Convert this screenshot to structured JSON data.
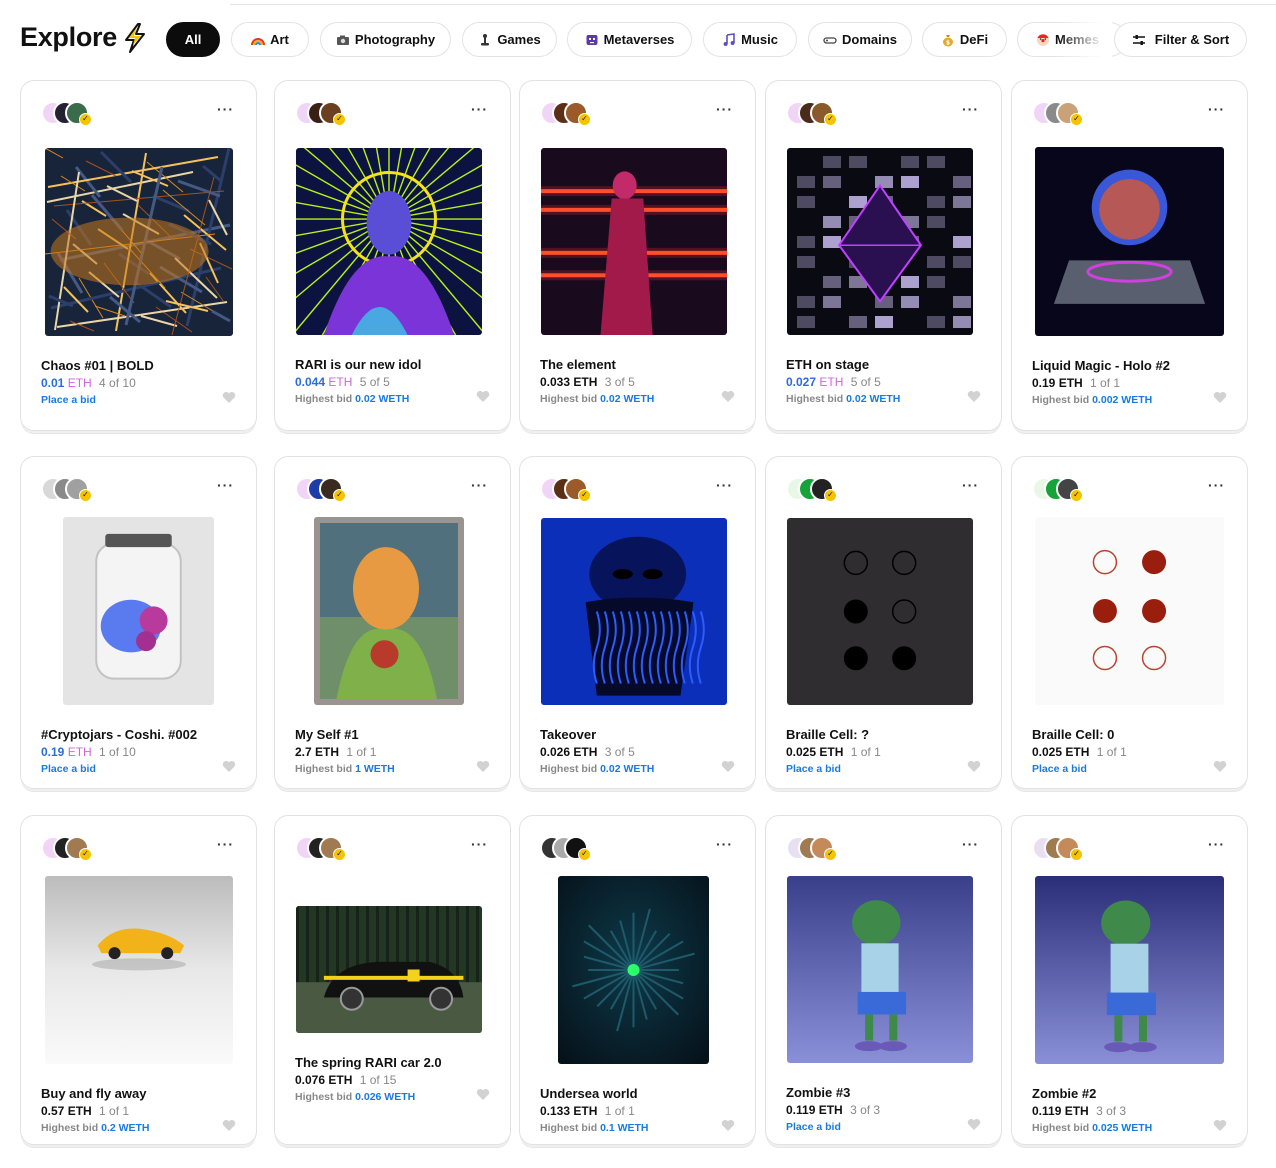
{
  "header": {
    "title": "Explore",
    "filters": [
      {
        "label": "All",
        "icon": "",
        "active": true
      },
      {
        "label": "Art",
        "icon": "rainbow-icon",
        "active": false
      },
      {
        "label": "Photography",
        "icon": "camera-icon",
        "active": false
      },
      {
        "label": "Games",
        "icon": "joystick-icon",
        "active": false
      },
      {
        "label": "Metaverses",
        "icon": "alien-icon",
        "active": false
      },
      {
        "label": "Music",
        "icon": "music-note-icon",
        "active": false
      },
      {
        "label": "Domains",
        "icon": "domain-icon",
        "active": false
      },
      {
        "label": "DeFi",
        "icon": "money-bag-icon",
        "active": false
      },
      {
        "label": "Memes",
        "icon": "clown-icon",
        "active": false
      }
    ],
    "filter_sort_label": "Filter & Sort"
  },
  "colors": {
    "accent_blue": "#2a6bde",
    "eth_pink": "#d163e0",
    "link_blue": "#1a7ae0"
  },
  "cards": [
    {
      "name": "Chaos #01 | BOLD",
      "price": "0.01",
      "currency": "ETH",
      "editions": "4 of 10",
      "bid_label": "Place a bid",
      "bid_value": "",
      "highlight": true
    },
    {
      "name": "RARI is our new idol",
      "price": "0.044",
      "currency": "ETH",
      "editions": "5 of 5",
      "bid_label": "Highest bid",
      "bid_value": "0.02 WETH",
      "highlight": true
    },
    {
      "name": "The element",
      "price": "0.033",
      "currency": "ETH",
      "editions": "3 of 5",
      "bid_label": "Highest bid",
      "bid_value": "0.02 WETH",
      "highlight": false
    },
    {
      "name": "ETH on stage",
      "price": "0.027",
      "currency": "ETH",
      "editions": "5 of 5",
      "bid_label": "Highest bid",
      "bid_value": "0.02 WETH",
      "highlight": true
    },
    {
      "name": "Liquid Magic - Holo #2",
      "price": "0.19",
      "currency": "ETH",
      "editions": "1 of 1",
      "bid_label": "Highest bid",
      "bid_value": "0.002 WETH",
      "highlight": false
    },
    {
      "name": "#Cryptojars - Coshi. #002",
      "price": "0.19",
      "currency": "ETH",
      "editions": "1 of 10",
      "bid_label": "Place a bid",
      "bid_value": "",
      "highlight": true
    },
    {
      "name": "My Self #1",
      "price": "2.7",
      "currency": "ETH",
      "editions": "1 of 1",
      "bid_label": "Highest bid",
      "bid_value": "1 WETH",
      "highlight": false
    },
    {
      "name": "Takeover",
      "price": "0.026",
      "currency": "ETH",
      "editions": "3 of 5",
      "bid_label": "Highest bid",
      "bid_value": "0.02 WETH",
      "highlight": false
    },
    {
      "name": "Braille Cell: ?",
      "price": "0.025",
      "currency": "ETH",
      "editions": "1 of 1",
      "bid_label": "Place a bid",
      "bid_value": "",
      "highlight": false
    },
    {
      "name": "Braille Cell: 0",
      "price": "0.025",
      "currency": "ETH",
      "editions": "1 of 1",
      "bid_label": "Place a bid",
      "bid_value": "",
      "highlight": false
    },
    {
      "name": "Buy and fly away",
      "price": "0.57",
      "currency": "ETH",
      "editions": "1 of 1",
      "bid_label": "Highest bid",
      "bid_value": "0.2 WETH",
      "highlight": false
    },
    {
      "name": "The spring RARI car 2.0",
      "price": "0.076",
      "currency": "ETH",
      "editions": "1 of 15",
      "bid_label": "Highest bid",
      "bid_value": "0.026 WETH",
      "highlight": false
    },
    {
      "name": "Undersea world",
      "price": "0.133",
      "currency": "ETH",
      "editions": "1 of 1",
      "bid_label": "Highest bid",
      "bid_value": "0.1 WETH",
      "highlight": false
    },
    {
      "name": "Zombie #3",
      "price": "0.119",
      "currency": "ETH",
      "editions": "3 of 3",
      "bid_label": "Place a bid",
      "bid_value": "",
      "highlight": false
    },
    {
      "name": "Zombie #2",
      "price": "0.119",
      "currency": "ETH",
      "editions": "3 of 3",
      "bid_label": "Highest bid",
      "bid_value": "0.025 WETH",
      "highlight": false
    }
  ]
}
